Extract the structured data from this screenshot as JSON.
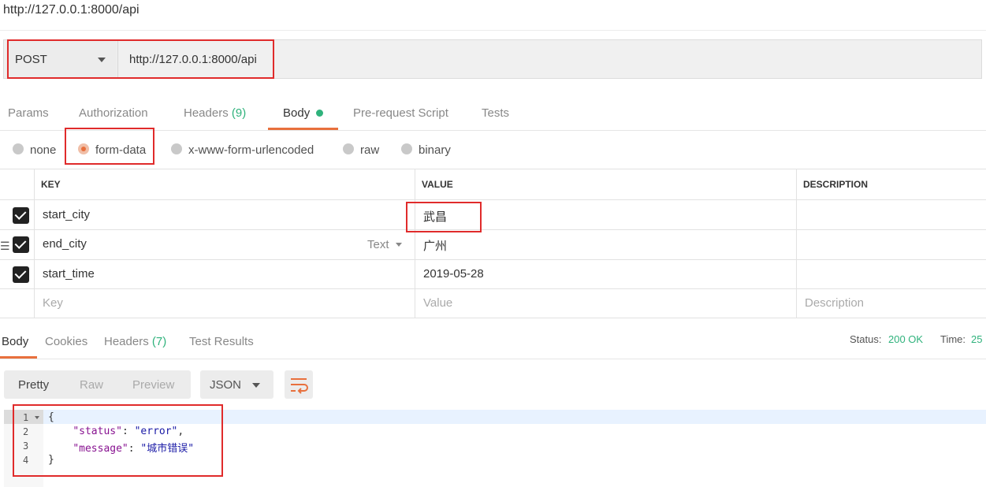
{
  "window": {
    "title": "http://127.0.0.1:8000/api"
  },
  "request": {
    "method": "POST",
    "url": "http://127.0.0.1:8000/api",
    "tabs": {
      "params": "Params",
      "authorization": "Authorization",
      "headers": "Headers",
      "headers_count": "(9)",
      "body": "Body",
      "pre_request": "Pre-request Script",
      "tests": "Tests"
    },
    "body_types": {
      "none": "none",
      "form_data": "form-data",
      "urlencoded": "x-www-form-urlencoded",
      "raw": "raw",
      "binary": "binary"
    },
    "selected_body_type": "form-data",
    "table": {
      "headers": {
        "key": "KEY",
        "value": "VALUE",
        "description": "DESCRIPTION"
      },
      "rows": [
        {
          "checked": true,
          "key": "start_city",
          "value": "武昌",
          "description": ""
        },
        {
          "checked": true,
          "key": "end_city",
          "value": "广州",
          "description": "",
          "type": "Text"
        },
        {
          "checked": true,
          "key": "start_time",
          "value": "2019-05-28",
          "description": ""
        }
      ],
      "placeholders": {
        "key": "Key",
        "value": "Value",
        "description": "Description"
      }
    }
  },
  "response": {
    "tabs": {
      "body": "Body",
      "cookies": "Cookies",
      "headers": "Headers",
      "headers_count": "(7)",
      "test_results": "Test Results"
    },
    "status_label": "Status:",
    "status_value": "200 OK",
    "time_label": "Time:",
    "time_value": "25",
    "view_modes": {
      "pretty": "Pretty",
      "raw": "Raw",
      "preview": "Preview"
    },
    "format": "JSON",
    "code": {
      "line_numbers": [
        "1",
        "2",
        "3",
        "4"
      ],
      "open_brace": "{",
      "close_brace": "}",
      "lines": [
        {
          "key": "\"status\"",
          "sep": ": ",
          "value": "\"error\"",
          "end": ","
        },
        {
          "key": "\"message\"",
          "sep": ": ",
          "value": "\"城市错误\"",
          "end": ""
        }
      ]
    }
  },
  "colors": {
    "accent": "#e8703d",
    "success": "#2fb27c",
    "highlight_box": "#e02b2b"
  }
}
